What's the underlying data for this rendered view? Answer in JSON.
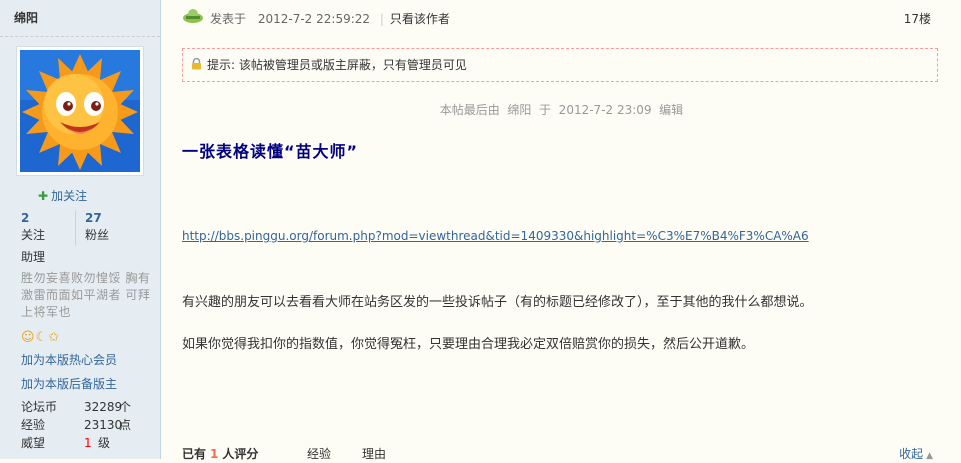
{
  "author": {
    "name": "绵阳",
    "follow_label": "加关注",
    "following_count": "2",
    "following_label": "关注",
    "fans_count": "27",
    "fans_label": "粉丝",
    "rank": "助理",
    "motto": "胜勿妄喜败勿惶馁 胸有激雷而面如平湖者 可拜上将军也",
    "medal_icons": [
      "sun-icon",
      "moon-icon",
      "star-icon"
    ],
    "link_fan": "加为本版热心会员",
    "link_mod": "加为本版后备版主",
    "stats": [
      {
        "key": "论坛币",
        "value": "32289",
        "unit": "个"
      },
      {
        "key": "经验",
        "value": "23130",
        "unit": "点"
      },
      {
        "key": "威望",
        "value": "1",
        "unit": "级"
      }
    ]
  },
  "post": {
    "posted_label": "发表于",
    "posted_time": "2012-7-2 22:59:22",
    "author_only": "只看该作者",
    "floor": "17楼",
    "notice": "提示: 该帖被管理员或版主屏蔽，只有管理员可见",
    "edited": "本帖最后由  绵阳  于  2012-7-2 23:09  编辑",
    "title": "一张表格读懂“苗大师”",
    "link": "http://bbs.pinggu.org/forum.php?mod=viewthread&tid=1409330&highlight=%C3%E7%B4%F3%CA%A6",
    "paragraph1": "有兴趣的朋友可以去看看大师在站务区发的一些投诉帖子（有的标题已经修改了），至于其他的我什么都想说。",
    "paragraph2": "如果你觉得我扣你的指数值，你觉得冤枉，只要理由合理我必定双倍赔赏你的损失，然后公开道歉。"
  },
  "rating": {
    "prefix": "已有",
    "count": "1",
    "suffix": "人评分",
    "col_exp": "经验",
    "col_reason": "理由",
    "collapse": "收起"
  },
  "colors": {
    "sidebar_bg": "#E5EDF2",
    "link": "#336699",
    "title": "#000080",
    "notice_border": "#FF9A9A"
  }
}
